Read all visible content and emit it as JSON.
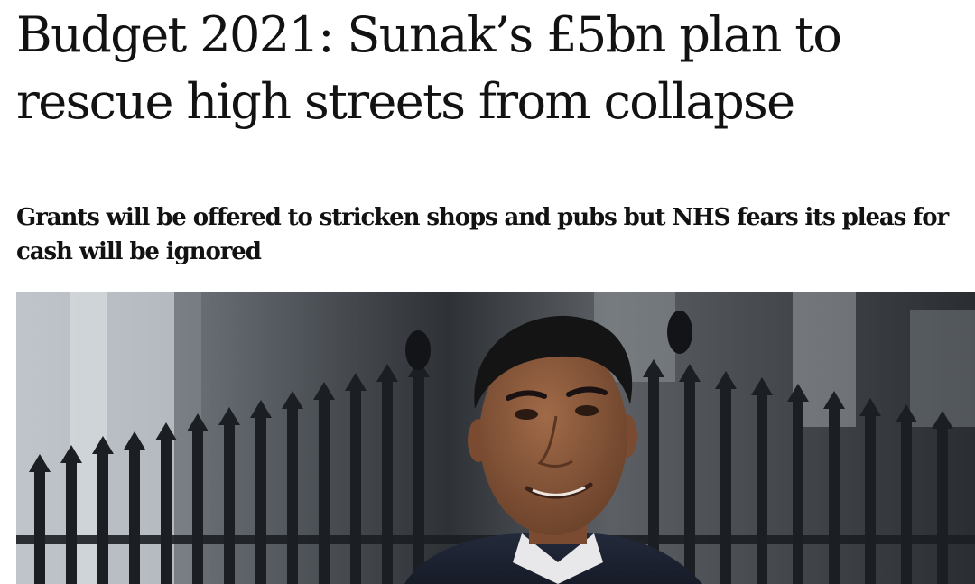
{
  "article": {
    "headline": "Budget 2021: Sunak’s £5bn plan to rescue high streets from collapse",
    "standfirst": "Grants will be offered to stricken shops and pubs but NHS fears its pleas for cash will be ignored"
  },
  "photo": {
    "subject": "man-in-suit-outside-railings",
    "palette": {
      "background": "#3a3d42",
      "railings": "#1e2125",
      "wall_light": "#c7ccd1",
      "skin": "#8a5a3e",
      "hair": "#151515",
      "suit": "#1f2535"
    }
  }
}
